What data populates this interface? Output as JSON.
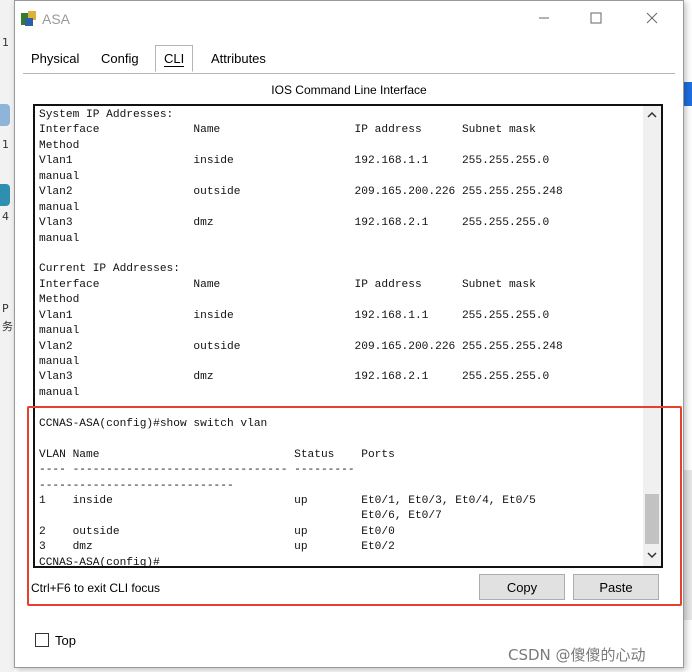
{
  "window": {
    "title": "ASA",
    "controls": {
      "minimize": "—",
      "maximize": "☐",
      "close": "✕"
    }
  },
  "tabs": [
    {
      "label": "Physical",
      "active": false
    },
    {
      "label": "Config",
      "active": false
    },
    {
      "label": "CLI",
      "active": true
    },
    {
      "label": "Attributes",
      "active": false
    }
  ],
  "panel": {
    "title": "IOS Command Line Interface"
  },
  "terminal": {
    "lines": [
      "System IP Addresses:",
      "Interface              Name                    IP address      Subnet mask",
      "Method",
      "Vlan1                  inside                  192.168.1.1     255.255.255.0",
      "manual",
      "Vlan2                  outside                 209.165.200.226 255.255.255.248",
      "manual",
      "Vlan3                  dmz                     192.168.2.1     255.255.255.0",
      "manual",
      "",
      "Current IP Addresses:",
      "Interface              Name                    IP address      Subnet mask",
      "Method",
      "Vlan1                  inside                  192.168.1.1     255.255.255.0",
      "manual",
      "Vlan2                  outside                 209.165.200.226 255.255.255.248",
      "manual",
      "Vlan3                  dmz                     192.168.2.1     255.255.255.0",
      "manual",
      "",
      "CCNAS-ASA(config)#show switch vlan",
      "",
      "VLAN Name                             Status    Ports",
      "---- -------------------------------- ---------",
      "-----------------------------",
      "1    inside                           up        Et0/1, Et0/3, Et0/4, Et0/5",
      "                                                Et0/6, Et0/7",
      "2    outside                          up        Et0/0",
      "3    dmz                              up        Et0/2",
      "CCNAS-ASA(config)#"
    ]
  },
  "footer": {
    "hint": "Ctrl+F6 to exit CLI focus",
    "copy_label": "Copy",
    "paste_label": "Paste"
  },
  "top_checkbox": {
    "label": "Top",
    "checked": false
  },
  "watermark": "CSDN @傻傻的心动",
  "colors": {
    "highlight": "#e8402e",
    "accent_strip": "#1e6fe0"
  }
}
